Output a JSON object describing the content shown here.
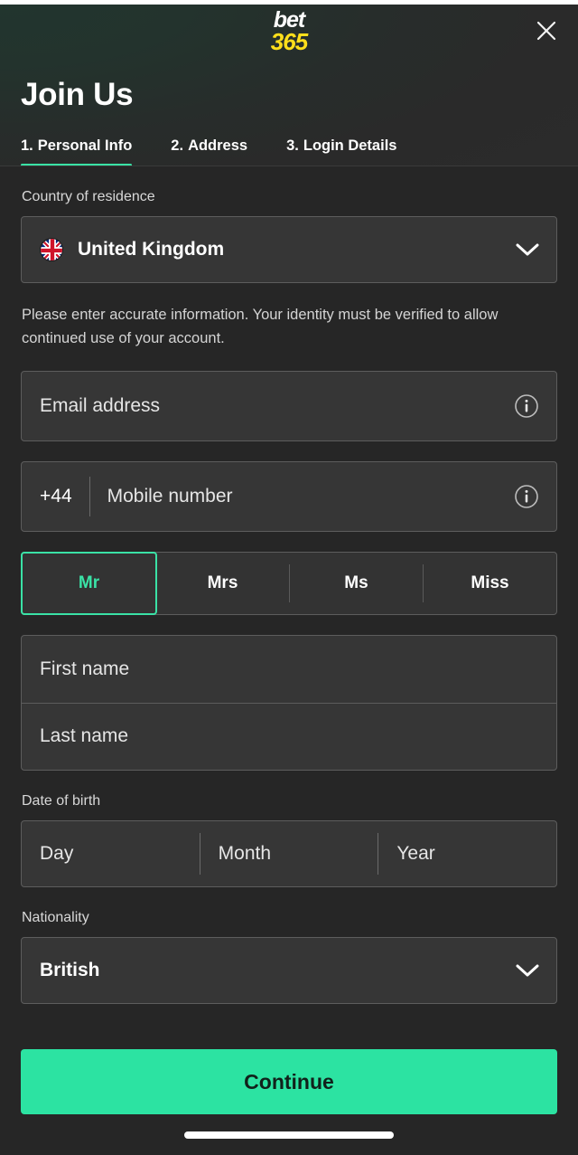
{
  "brand": {
    "logo_top": "bet",
    "logo_bottom": "365",
    "logo_top_color": "#ffffff",
    "logo_bottom_color": "#ffdf1b",
    "accent_color": "#3ae2a6",
    "cta_color": "#2ce3a2"
  },
  "header": {
    "close_label": "Close",
    "title": "Join Us",
    "tabs": [
      {
        "num": "1.",
        "label": "Personal Info",
        "active": true
      },
      {
        "num": "2.",
        "label": "Address",
        "active": false
      },
      {
        "num": "3.",
        "label": "Login Details",
        "active": false
      }
    ]
  },
  "form": {
    "country_label": "Country of residence",
    "country_value": "United Kingdom",
    "country_flag": "uk-flag-icon",
    "helper_text": "Please enter accurate information. Your identity must be verified to allow continued use of your account.",
    "email_placeholder": "Email address",
    "phone_prefix": "+44",
    "phone_placeholder": "Mobile number",
    "titles": [
      {
        "label": "Mr",
        "selected": true
      },
      {
        "label": "Mrs",
        "selected": false
      },
      {
        "label": "Ms",
        "selected": false
      },
      {
        "label": "Miss",
        "selected": false
      }
    ],
    "first_name_placeholder": "First name",
    "last_name_placeholder": "Last name",
    "dob_label": "Date of birth",
    "dob_day_placeholder": "Day",
    "dob_month_placeholder": "Month",
    "dob_year_placeholder": "Year",
    "nationality_label": "Nationality",
    "nationality_value": "British"
  },
  "footer": {
    "continue_label": "Continue"
  }
}
